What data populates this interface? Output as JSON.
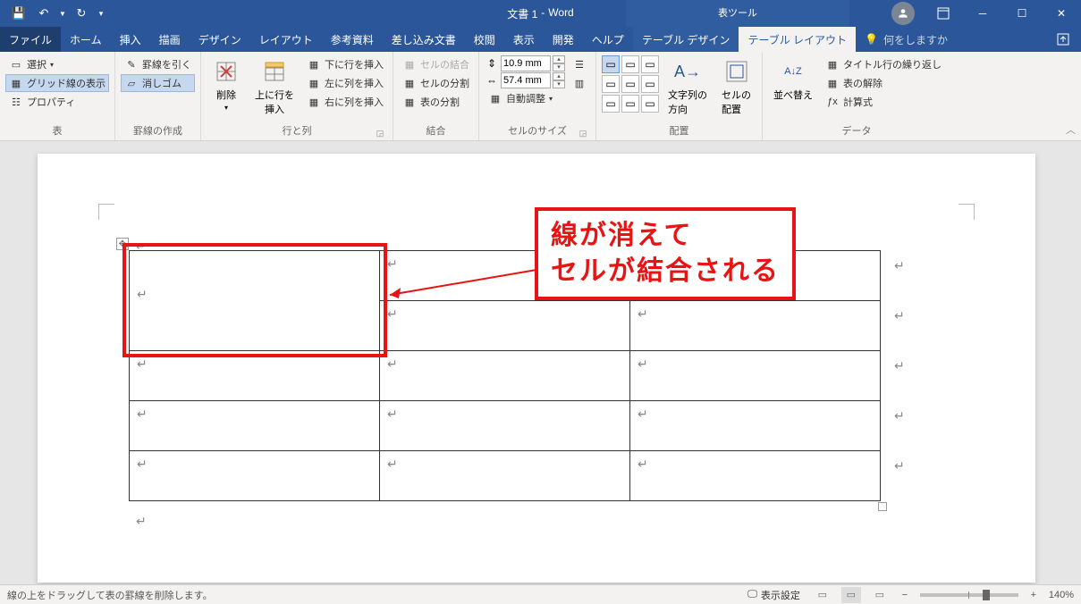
{
  "title": {
    "doc": "文書 1",
    "sep": "-",
    "app": "Word",
    "context": "表ツール"
  },
  "qat": {
    "save": "保存",
    "undo": "元に戻す",
    "redo": "やり直し",
    "customize": "▾"
  },
  "window": {
    "ribbon_opts": "�り",
    "min": "−",
    "max": "□",
    "close": "✕"
  },
  "tabs": {
    "file": "ファイル",
    "home": "ホーム",
    "insert": "挿入",
    "draw": "描画",
    "design": "デザイン",
    "layout": "レイアウト",
    "references": "参考資料",
    "mailings": "差し込み文書",
    "review": "校閲",
    "view": "表示",
    "developer": "開発",
    "help": "ヘルプ",
    "table_design": "テーブル デザイン",
    "table_layout": "テーブル レイアウト",
    "tell_me": "何をしますか"
  },
  "ribbon": {
    "table_group": {
      "select": "選択",
      "gridlines": "グリッド線の表示",
      "properties": "プロパティ",
      "label": "表"
    },
    "draw_group": {
      "draw": "罫線を引く",
      "eraser": "消しゴム",
      "label": "罫線の作成"
    },
    "rowscols": {
      "delete": "削除",
      "insert_above": "上に行を\n挿入",
      "insert_below": "下に行を挿入",
      "insert_left": "左に列を挿入",
      "insert_right": "右に列を挿入",
      "label": "行と列"
    },
    "merge": {
      "merge_cells": "セルの結合",
      "split_cells": "セルの分割",
      "split_table": "表の分割",
      "label": "結合"
    },
    "size": {
      "height": "10.9 mm",
      "width": "57.4 mm",
      "autofit": "自動調整",
      "label": "セルのサイズ",
      "dist_rows": "行の高さを揃える",
      "dist_cols": "列の幅を揃える"
    },
    "align": {
      "direction": "文字列の\n方向",
      "margins": "セルの\n配置",
      "label": "配置"
    },
    "data": {
      "sort": "並べ替え",
      "repeat_header": "タイトル行の繰り返し",
      "convert": "表の解除",
      "formula": "計算式",
      "label": "データ"
    }
  },
  "callout": {
    "line1": "線が消えて",
    "line2": "セルが結合される"
  },
  "status": {
    "msg": "線の上をドラッグして表の罫線を削除します。",
    "display_settings": "表示設定",
    "zoom": "140%"
  },
  "marks": {
    "para": "↵",
    "cell": "↵"
  }
}
